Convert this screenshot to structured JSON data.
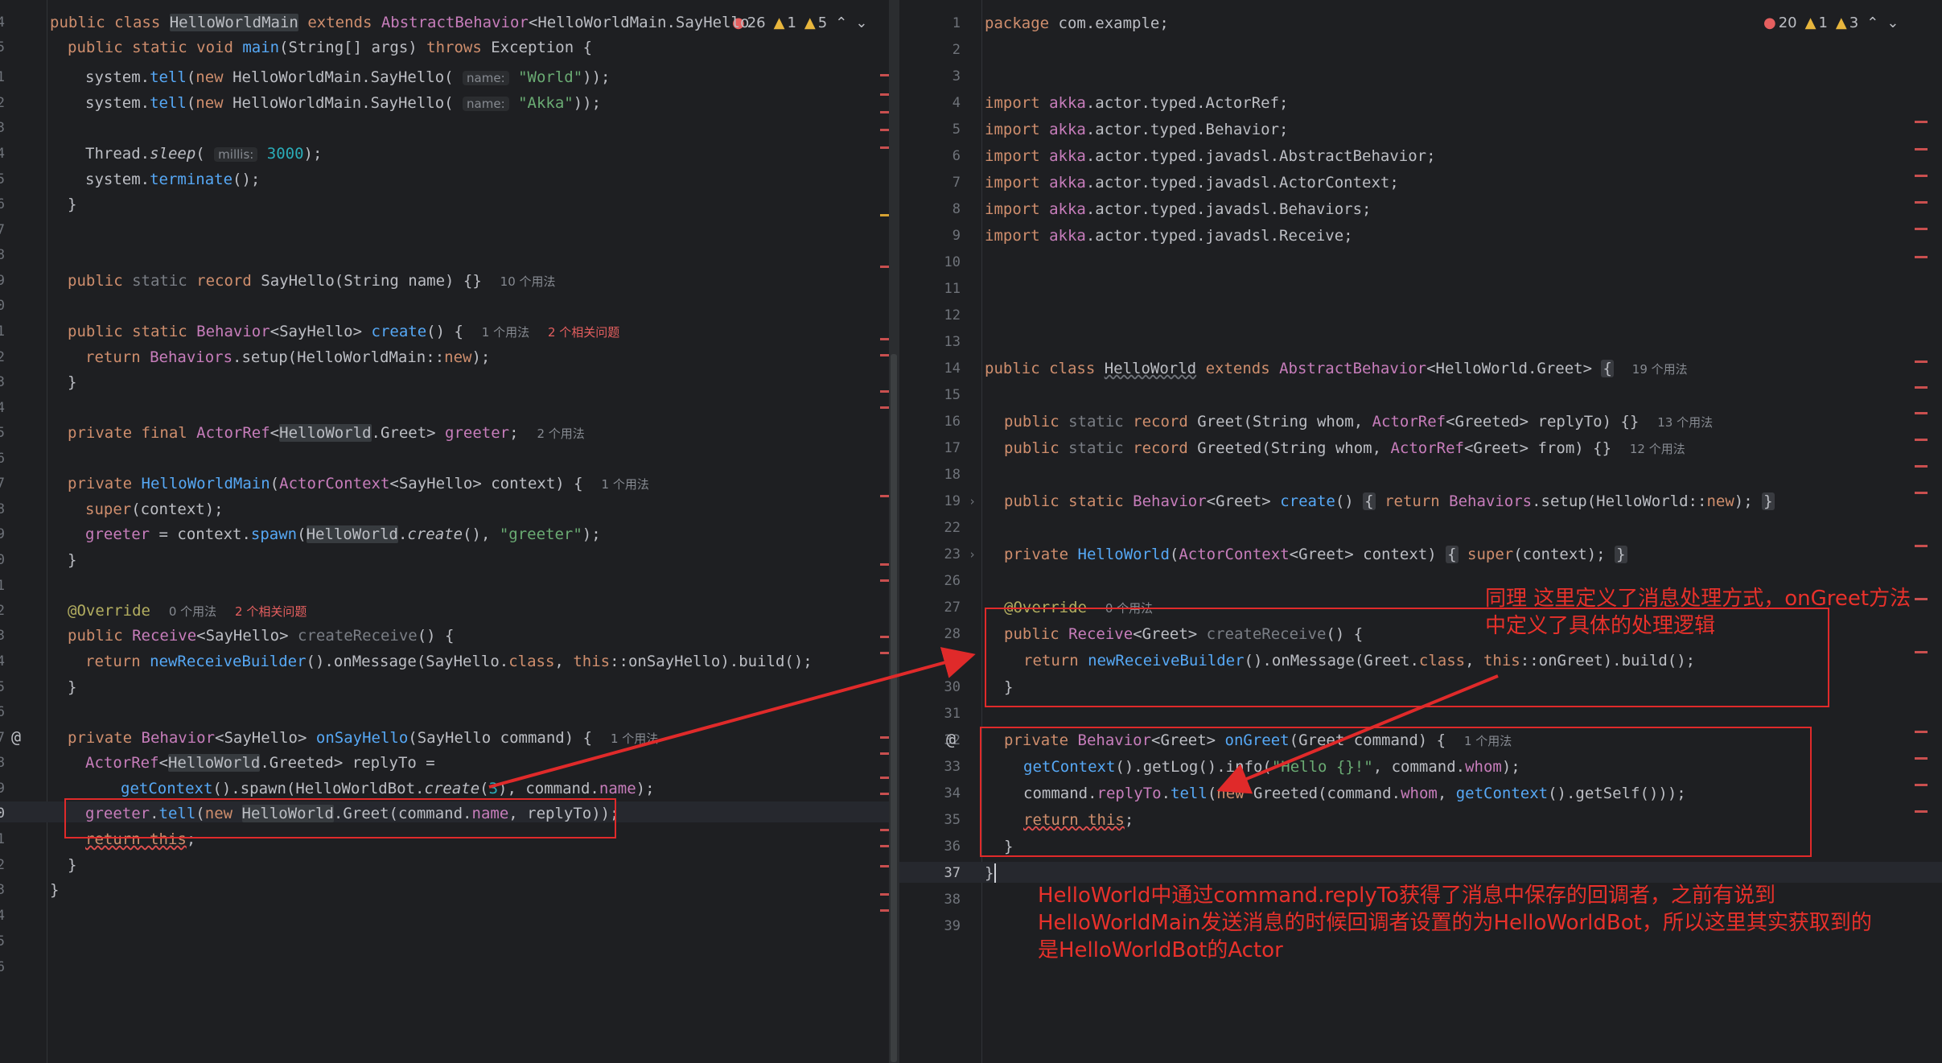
{
  "left_editor": {
    "header": "public class HelloWorldMain extends AbstractBehavior<HelloWorldMain.SayHello",
    "errors": "26",
    "warnings": "1",
    "weak_warnings": "5",
    "line_numbers": [
      "4",
      "5",
      "1",
      "2",
      "3",
      "4",
      "5",
      "6",
      "7",
      "8",
      "9",
      "0",
      "1",
      "2",
      "3",
      "4",
      "5",
      "6",
      "7",
      "8",
      "9",
      "0",
      "1",
      "2",
      "3",
      "4",
      "5",
      "6",
      "7",
      "8",
      "9",
      "0",
      "1",
      "2",
      "3",
      "4",
      "5",
      "6"
    ],
    "hint_name": "name:",
    "hint_millis": "millis:",
    "usage_10": "10 个用法",
    "usage_1": "1 个用法",
    "usage_2": "2 个用法",
    "usage_0": "0 个用法",
    "problems_2": "2 个相关问题"
  },
  "right_editor": {
    "errors": "20",
    "warnings": "1",
    "weak_warnings": "3",
    "line_numbers": [
      "1",
      "2",
      "3",
      "4",
      "5",
      "6",
      "7",
      "8",
      "9",
      "10",
      "11",
      "12",
      "13",
      "14",
      "15",
      "16",
      "17",
      "18",
      "19",
      "22",
      "23",
      "26",
      "27",
      "28",
      "29",
      "30",
      "31",
      "32",
      "33",
      "34",
      "35",
      "36",
      "37",
      "38",
      "39"
    ],
    "usage_19": "19 个用法",
    "usage_13": "13 个用法",
    "usage_12": "12 个用法",
    "usage_0": "0 个用法",
    "usage_1": "1 个用法"
  },
  "annotations": {
    "note_top_1": "同理 这里定义了消息处理方式，onGreet方法",
    "note_top_2": "中定义了具体的处理逻辑",
    "note_bottom_1": "HelloWorld中通过command.replyTo获得了消息中保存的回调者，之前有说到",
    "note_bottom_2": "HelloWorldMain发送消息的时候回调者设置的为HelloWorldBot，所以这里其实获取到的",
    "note_bottom_3": "是HelloWorldBot的Actor"
  },
  "icons": [
    "error-icon",
    "warning-icon",
    "weak-warning-icon",
    "chevron-up-icon",
    "chevron-down-icon",
    "override-at-icon",
    "fold-arrow-icon"
  ],
  "colors": {
    "annotation_red": "#e02a2a",
    "editor_bg": "#1e1f22",
    "accent": "#3574f0"
  }
}
